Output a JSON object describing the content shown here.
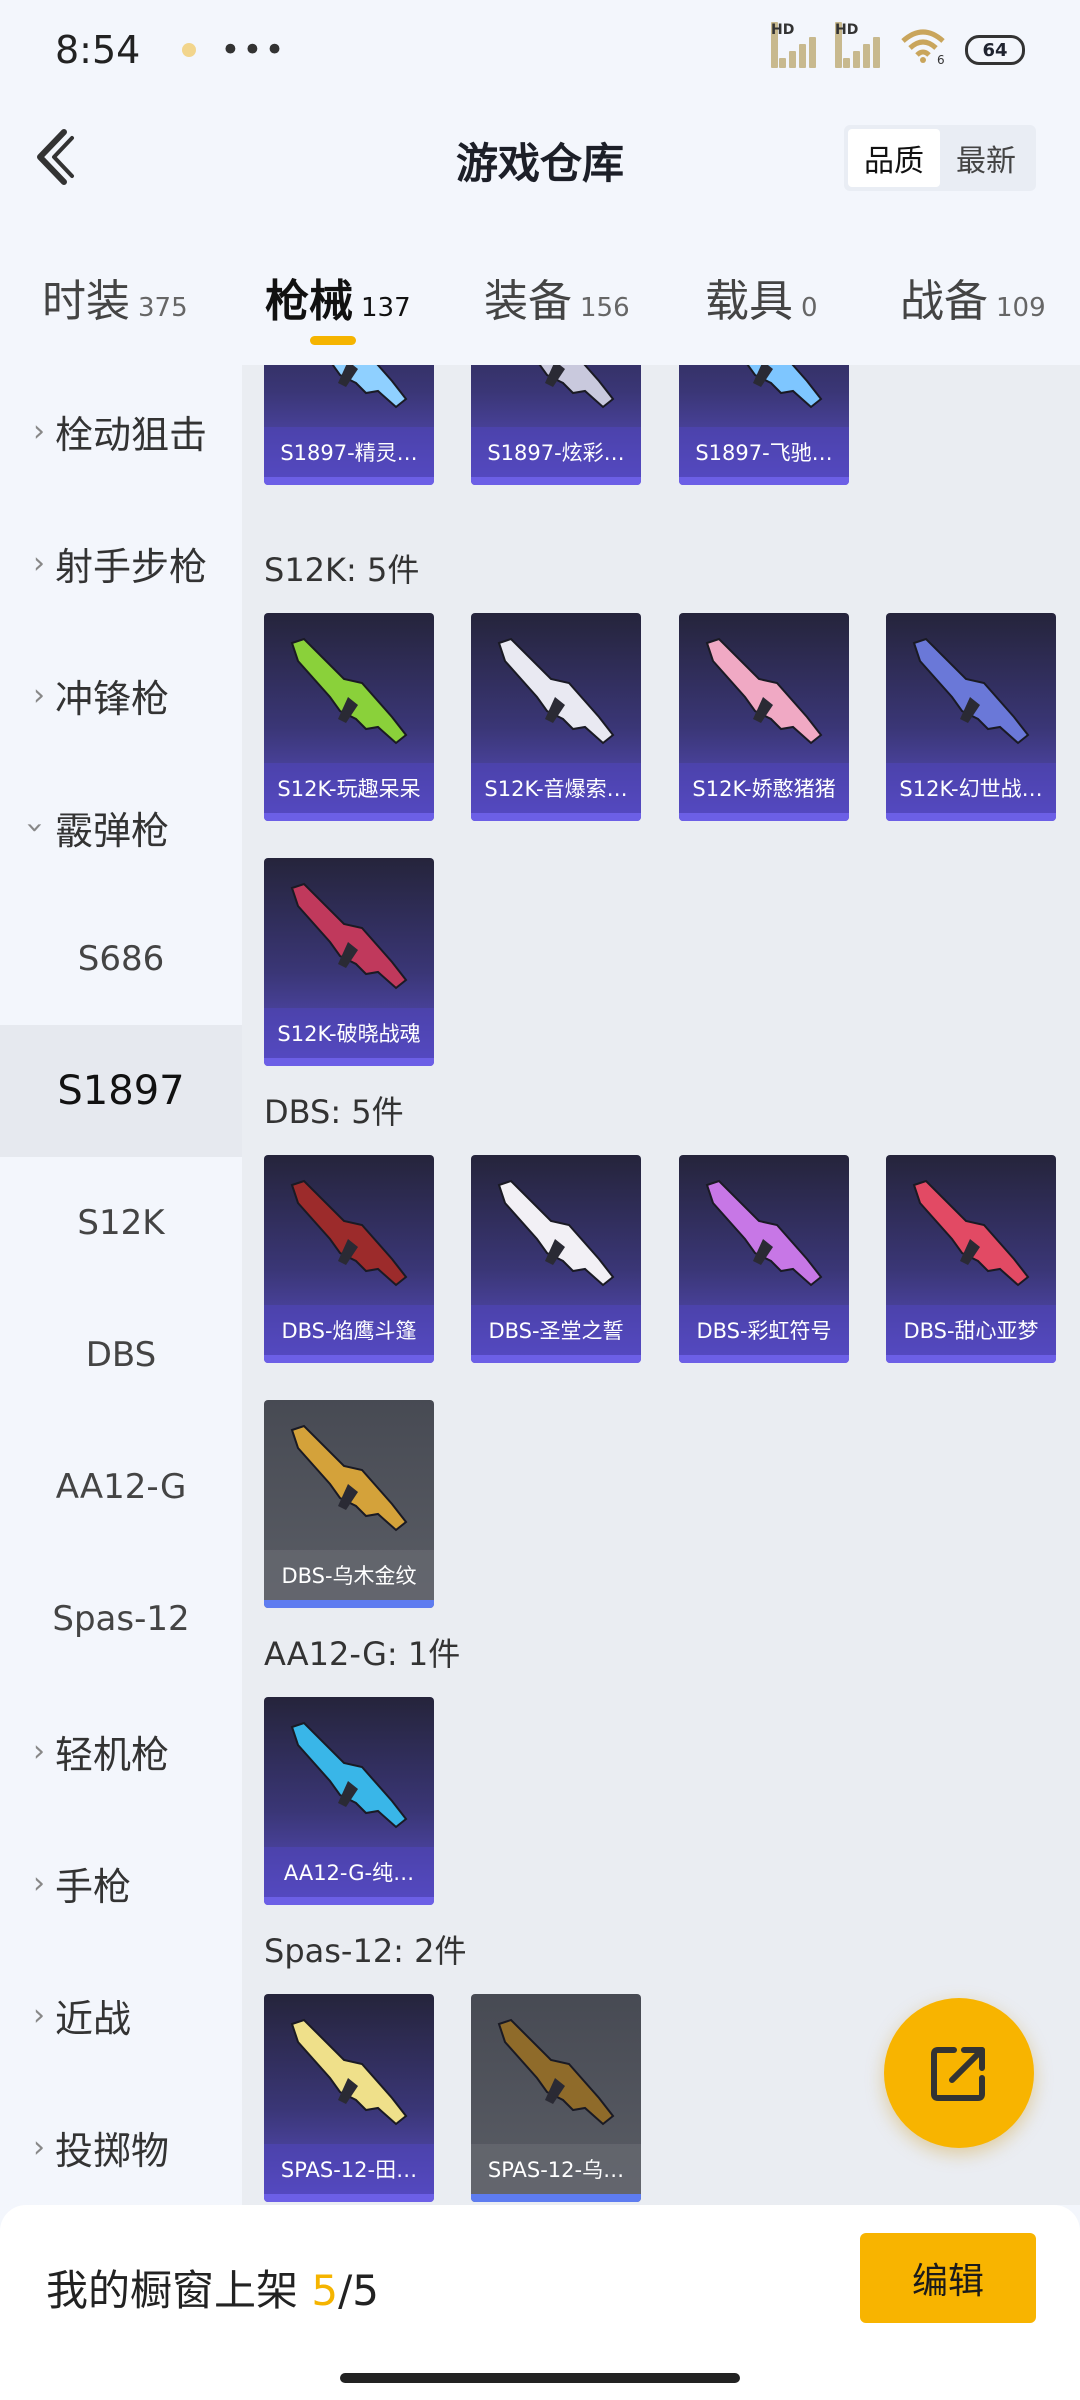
{
  "status_bar": {
    "time": "8:54",
    "more": "•••",
    "signal_1_badge": "HD",
    "signal_2_badge": "HD",
    "wifi_badge": "6",
    "battery": "64"
  },
  "header": {
    "title": "游戏仓库",
    "sort_options": [
      "品质",
      "最新"
    ],
    "selected_sort": "品质"
  },
  "tabs": [
    {
      "label": "时装",
      "count": "375"
    },
    {
      "label": "枪械",
      "count": "137"
    },
    {
      "label": "装备",
      "count": "156"
    },
    {
      "label": "载具",
      "count": "0"
    },
    {
      "label": "战备",
      "count": "109"
    }
  ],
  "active_tab": "枪械",
  "sidebar": {
    "categories": [
      "栓动狙击",
      "射手步枪",
      "冲锋枪",
      "霰弹枪",
      "轻机枪",
      "手枪",
      "近战",
      "投掷物"
    ],
    "expanded": "霰弹枪",
    "subcategories": [
      "S686",
      "S1897",
      "S12K",
      "DBS",
      "AA12-G",
      "Spas-12"
    ],
    "selected_sub": "S1897"
  },
  "sections": [
    {
      "title": "",
      "items": [
        {
          "name": "S1897-精灵…",
          "style": "purple",
          "color": "#8fd0ff"
        },
        {
          "name": "S1897-炫彩…",
          "style": "purple",
          "color": "#c9c9dd"
        },
        {
          "name": "S1897-飞驰…",
          "style": "purple",
          "color": "#7ec6ff"
        }
      ]
    },
    {
      "title": "S12K: 5件",
      "items": [
        {
          "name": "S12K-玩趣呆呆",
          "style": "purple",
          "color": "#8ad13a"
        },
        {
          "name": "S12K-音爆索…",
          "style": "purple",
          "color": "#e9e9f2"
        },
        {
          "name": "S12K-娇憨猪猪",
          "style": "purple",
          "color": "#f0a9c4"
        },
        {
          "name": "S12K-幻世战…",
          "style": "purple",
          "color": "#6a78d8"
        },
        {
          "name": "S12K-破晓战魂",
          "style": "purple",
          "color": "#c0395c"
        }
      ]
    },
    {
      "title": "DBS: 5件",
      "items": [
        {
          "name": "DBS-焰鹰斗篷",
          "style": "purple",
          "color": "#9c2b2b"
        },
        {
          "name": "DBS-圣堂之誓",
          "style": "purple",
          "color": "#f2f0f5"
        },
        {
          "name": "DBS-彩虹符号",
          "style": "purple",
          "color": "#c777e6"
        },
        {
          "name": "DBS-甜心亚梦",
          "style": "purple",
          "color": "#e24a64"
        },
        {
          "name": "DBS-乌木金纹",
          "style": "gray",
          "color": "#d4a23a"
        }
      ]
    },
    {
      "title": "AA12-G: 1件",
      "items": [
        {
          "name": "AA12-G-纯…",
          "style": "purple",
          "color": "#39b6e8"
        }
      ]
    },
    {
      "title": "Spas-12: 2件",
      "items": [
        {
          "name": "SPAS-12-田…",
          "style": "purple",
          "color": "#efe08a"
        },
        {
          "name": "SPAS-12-乌…",
          "style": "gray",
          "color": "#8f6b2a"
        }
      ]
    }
  ],
  "bottom": {
    "label": "我的橱窗上架",
    "count": "5",
    "total": "/5",
    "edit_label": "编辑"
  },
  "icons": {
    "back": "back-arrow-icon",
    "fab": "share-export-icon"
  }
}
